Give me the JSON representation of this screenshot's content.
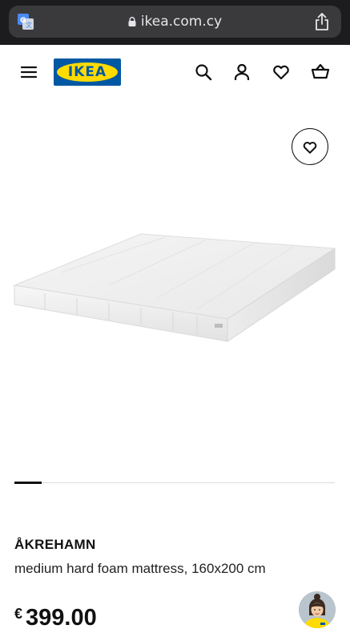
{
  "browser": {
    "url": "ikea.com.cy"
  },
  "header": {
    "logo_text": "IKEA"
  },
  "product": {
    "name": "ÅKREHAMN",
    "description": "medium hard foam mattress, 160x200 cm",
    "currency": "€",
    "price": "399.00"
  },
  "gallery": {
    "current_index": 1
  },
  "colors": {
    "brand_blue": "#0058a3",
    "brand_yellow": "#ffdb00",
    "browser_bar": "#1c1c1e"
  },
  "icons": [
    "translate-icon",
    "lock-icon",
    "share-icon",
    "menu-icon",
    "search-icon",
    "account-icon",
    "heart-icon",
    "cart-icon",
    "assistant-avatar-icon"
  ]
}
